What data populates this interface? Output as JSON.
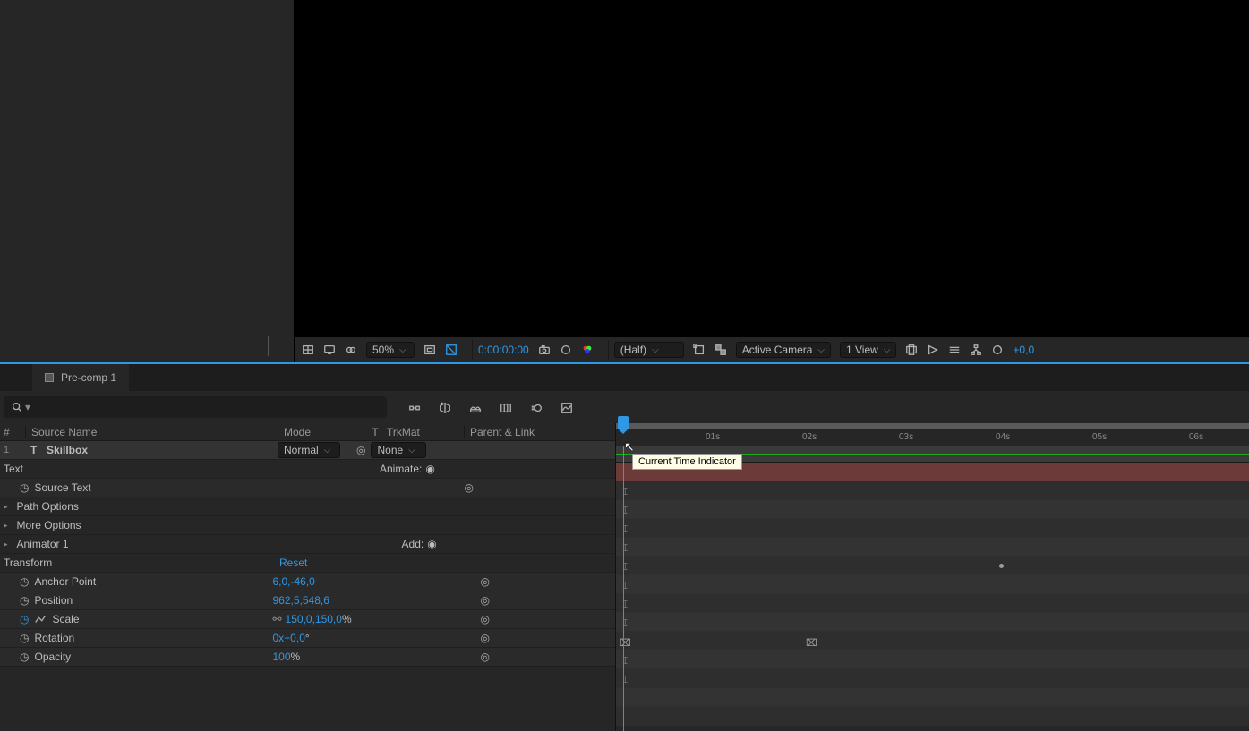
{
  "tab": {
    "name": "Pre-comp 1"
  },
  "compFooter": {
    "zoom": "50%",
    "timecode": "0:00:00:00",
    "resolution": "(Half)",
    "camera": "Active Camera",
    "view": "1 View",
    "exposure": "+0,0"
  },
  "search": {
    "placeholder": ""
  },
  "headers": {
    "hash": "#",
    "sourceName": "Source Name",
    "mode": "Mode",
    "t": "T",
    "trkMat": "TrkMat",
    "parent": "Parent & Link"
  },
  "layer": {
    "index": "1",
    "name": "Skillbox",
    "mode": "Normal",
    "trkMat": "None"
  },
  "groups": {
    "text": "Text",
    "animate": "Animate:",
    "sourceText": "Source Text",
    "pathOptions": "Path Options",
    "moreOptions": "More Options",
    "animator1": "Animator 1",
    "add": "Add:",
    "transform": "Transform",
    "reset": "Reset"
  },
  "props": {
    "anchorPoint": {
      "label": "Anchor Point",
      "value": "6,0,-46,0"
    },
    "position": {
      "label": "Position",
      "value": "962,5,548,6"
    },
    "scale": {
      "label": "Scale",
      "value": "150,0,150,0",
      "unit": "%"
    },
    "rotation": {
      "label": "Rotation",
      "prefix": "0x",
      "value": "+0,0",
      "unit": "°"
    },
    "opacity": {
      "label": "Opacity",
      "value": "100",
      "unit": "%"
    }
  },
  "ruler": [
    "01s",
    "02s",
    "03s",
    "04s",
    "05s",
    "06s"
  ],
  "tooltip": "Current Time Indicator"
}
